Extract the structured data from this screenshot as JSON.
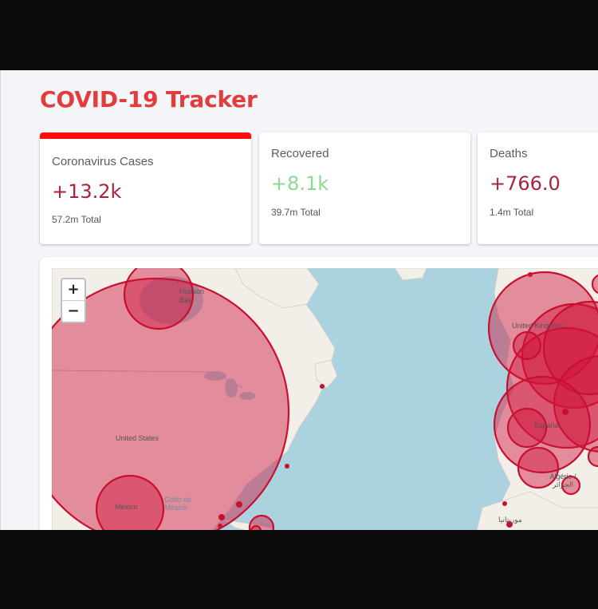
{
  "header": {
    "title": "COVID-19 Tracker"
  },
  "stats": [
    {
      "label": "Coronavirus Cases",
      "change": "+13.2k",
      "total": "57.2m Total",
      "color": "#a8243a",
      "active": true,
      "accent": "#ff0000"
    },
    {
      "label": "Recovered",
      "change": "+8.1k",
      "total": "39.7m Total",
      "color": "#8fd88f",
      "active": false
    },
    {
      "label": "Deaths",
      "change": "+766.0",
      "total": "1.4m Total",
      "color": "#a8243a",
      "active": false
    }
  ],
  "map": {
    "zoom_in": "+",
    "zoom_out": "−",
    "labels": {
      "united_states": "United States",
      "mexico": "México",
      "gulf": "Golfo de México",
      "hudson": "Hudson Bay",
      "united_kingdom": "United Kingdom",
      "espana": "España",
      "algerie": "Algérie / الجزائر",
      "mauritania": "موريتانيا"
    },
    "circle_color": "#d0143c"
  }
}
